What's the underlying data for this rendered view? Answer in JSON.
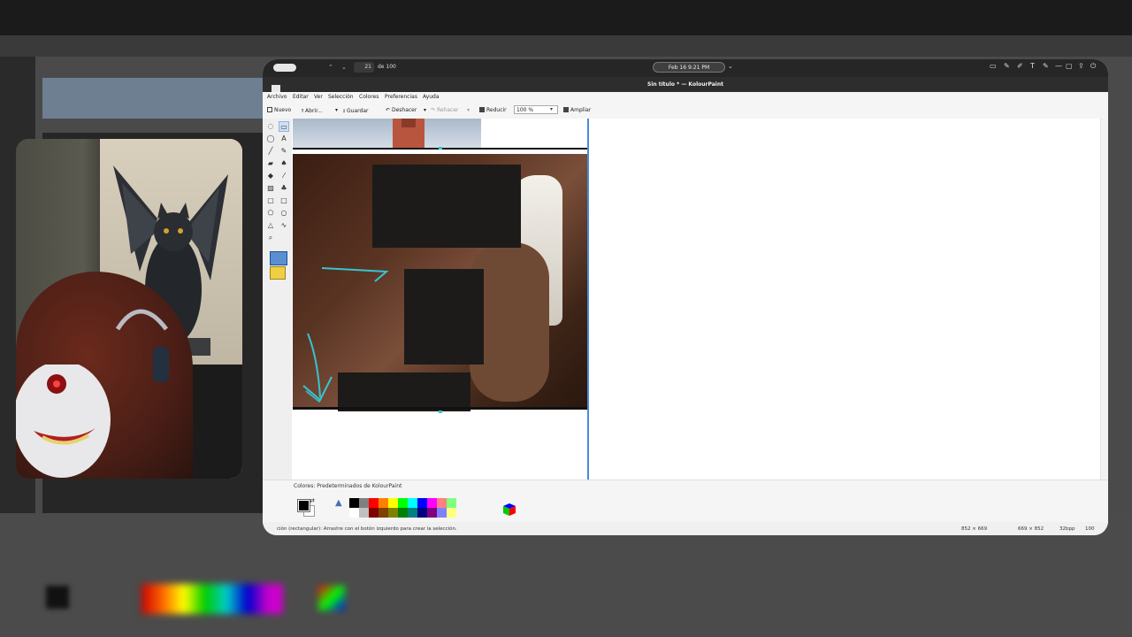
{
  "os_bar": {
    "page_current": "21",
    "page_total": "de 100",
    "datetime": "Feb 16   9:21 PM"
  },
  "window": {
    "title": "Sin título * — KolourPaint"
  },
  "menu": [
    "Archivo",
    "Editar",
    "Ver",
    "Selección",
    "Colores",
    "Preferencias",
    "Ayuda"
  ],
  "toolbar": {
    "new_label": "Nuevo",
    "open_label": "Abrir...",
    "save_label": "Guardar",
    "undo_label": "Deshacer",
    "redo_label": "Rehacer",
    "zoom_out_label": "Reducir",
    "zoom_value": "100 %",
    "zoom_in_label": "Ampliar"
  },
  "palette": {
    "label": "Colores: Predeterminados de KolourPaint",
    "foreground": "#000000",
    "background": "#ffffff",
    "swatches_top": [
      "#000000",
      "#808080",
      "#ff0000",
      "#ff8000",
      "#ffff00",
      "#00ff00",
      "#00ffff",
      "#0000ff",
      "#ff00ff",
      "#ff8080",
      "#80ff80"
    ],
    "swatches_bottom": [
      "#ffffff",
      "#c0c0c0",
      "#800000",
      "#804000",
      "#808000",
      "#008000",
      "#008080",
      "#000080",
      "#800080",
      "#8080ff",
      "#ffff80"
    ]
  },
  "status": {
    "message": "ción (rectangular): Arrastre con el botón izquierdo para crear la selección.",
    "size1": "852 × 669",
    "size2": "669 × 852",
    "depth": "32bpp",
    "zoom": "100"
  },
  "icons": {
    "undo": "undo-arrow-icon",
    "redo": "redo-arrow-icon",
    "color_picker": "color-picker-icon",
    "rgb_cube": "rgb-cube-icon"
  },
  "accent_color": "#4a8ad8",
  "annotation_color": "#37c4cf"
}
